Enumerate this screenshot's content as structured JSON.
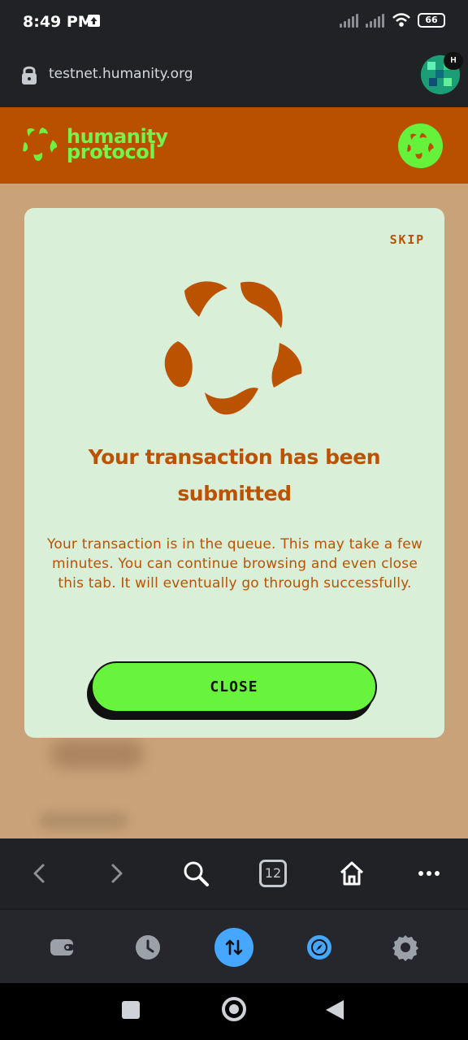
{
  "status": {
    "time": "8:49 PM",
    "upload_icon": "upload-icon",
    "signal_icons": [
      "signal-icon",
      "signal-icon"
    ],
    "wifi_icon": "wifi-icon",
    "battery": "66"
  },
  "browser": {
    "url": "testnet.humanity.org",
    "lock_icon": "lock-icon",
    "profile_badge": "H"
  },
  "site": {
    "brand_line1": "humanity",
    "brand_line2": "protocol",
    "accent": "#b85000",
    "brand_green": "#6ef23f"
  },
  "modal": {
    "skip": "SKIP",
    "title": "Your transaction has been submitted",
    "message": "Your transaction is in the queue. This may take a few minutes. You can continue browsing and even close this tab. It will eventually go through successfully.",
    "close": "CLOSE"
  },
  "browser_nav": {
    "items": [
      "back-icon",
      "forward-icon",
      "search-icon",
      "tabs-count-icon",
      "home-icon",
      "more-icon"
    ],
    "tab_count": "12"
  },
  "bottom_toolbar": {
    "items": [
      "wallet-icon",
      "history-icon",
      "swap-icon",
      "compass-icon",
      "gear-icon"
    ],
    "active_color": "#45a7ff"
  },
  "system_nav": {
    "items": [
      "recent-apps-icon",
      "home-circle-icon",
      "back-triangle-icon"
    ]
  }
}
